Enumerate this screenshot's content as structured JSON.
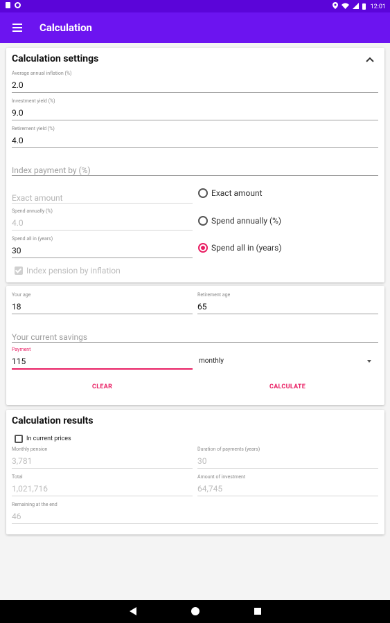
{
  "status_bar": {
    "time": "12:01"
  },
  "app_bar": {
    "title": "Calculation"
  },
  "settings": {
    "title": "Calculation settings",
    "inflation": {
      "label": "Average annual inflation (%)",
      "value": "2.0"
    },
    "investment_yield": {
      "label": "Investment yield (%)",
      "value": "9.0"
    },
    "retirement_yield": {
      "label": "Retirement yield (%)",
      "value": "4.0"
    },
    "index_payment": {
      "placeholder": "Index payment by (%)"
    },
    "exact_amount": {
      "placeholder": "Exact amount"
    },
    "spend_annually": {
      "label": "Spend annually (%)",
      "value": "4.0"
    },
    "spend_all_in": {
      "label": "Spend all in (years)",
      "value": "30"
    },
    "radio_options": [
      "Exact amount",
      "Spend annually (%)",
      "Spend all in (years)"
    ],
    "selected_option": "Spend all in (years)",
    "index_pension": "Index pension by inflation"
  },
  "inputs": {
    "your_age": {
      "label": "Your age",
      "value": "18"
    },
    "retirement_age": {
      "label": "Retirement age",
      "value": "65"
    },
    "current_savings": {
      "placeholder": "Your current savings"
    },
    "payment": {
      "label": "Payment",
      "value": "115"
    },
    "frequency": "monthly",
    "clear_label": "CLEAR",
    "calculate_label": "CALCULATE"
  },
  "results": {
    "title": "Calculation results",
    "in_current_prices": "In current prices",
    "monthly_pension": {
      "label": "Monthly pension",
      "value": "3,781"
    },
    "duration": {
      "label": "Duration of payments (years)",
      "value": "30"
    },
    "total": {
      "label": "Total",
      "value": "1,021,716"
    },
    "investment": {
      "label": "Amount of investment",
      "value": "64,745"
    },
    "remaining": {
      "label": "Remaining at the end",
      "value": "46"
    }
  },
  "colors": {
    "status_bar": "#5b05d9",
    "app_bar": "#6c14f0",
    "accent": "#e91e63"
  }
}
